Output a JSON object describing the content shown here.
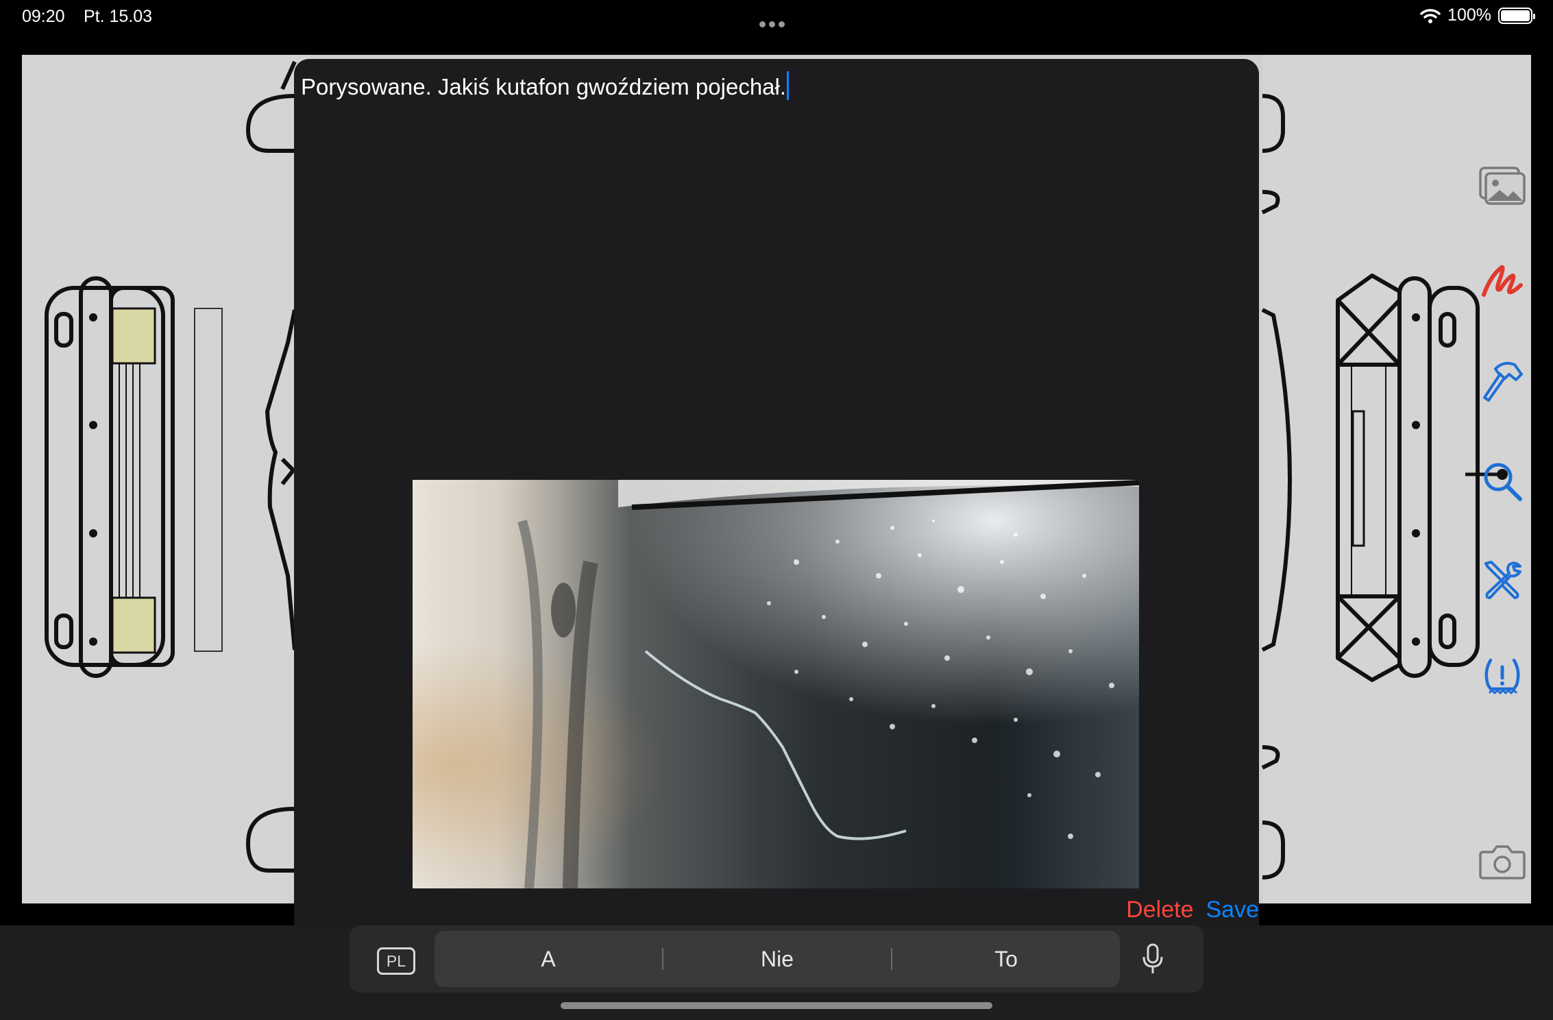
{
  "status_bar": {
    "time": "09:20",
    "date": "Pt. 15.03",
    "battery": "100%",
    "wifi_icon": "wifi-icon"
  },
  "toolbar": {
    "tools": [
      "gallery-icon",
      "scribble-icon",
      "hammer-icon",
      "search-icon",
      "repair-tools-icon",
      "tire-pressure-icon",
      "camera-icon"
    ],
    "colors": {
      "gray": "#7a7a7a",
      "red": "#e23a2e",
      "blue": "#1f6fd6"
    }
  },
  "note": {
    "text": "Porysowane. Jakiś kutafon gwoździem pojechał."
  },
  "actions": {
    "delete": "Delete",
    "save": "Save"
  },
  "keyboard": {
    "language": "PL",
    "suggestions": [
      "A",
      "Nie",
      "To"
    ]
  }
}
